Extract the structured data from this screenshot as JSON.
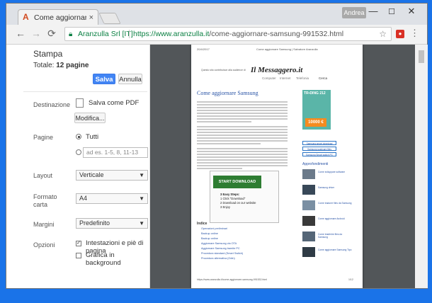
{
  "browser": {
    "tab_title": "Come aggiornare Samsu",
    "tab_close": "×",
    "user": "Andrea",
    "window_controls": [
      "—",
      "☐",
      "✕"
    ],
    "nav": [
      "←",
      "→",
      "⟳"
    ],
    "site_name": "Aranzulla Srl [IT]",
    "url_host": "https://www.aranzulla.it",
    "url_path": "/come-aggiornare-samsung-991532.html",
    "menu_icon": "⋮",
    "bookmark_icon": "☆"
  },
  "print": {
    "title": "Stampa",
    "total_label": "Totale:",
    "total_value": "12 pagine",
    "save_label": "Salva",
    "cancel_label": "Annulla",
    "destination_label": "Destinazione",
    "destination_value": "Salva come PDF",
    "modify_label": "Modifica...",
    "pages_label": "Pagine",
    "pages_all": "Tutti",
    "pages_range_placeholder": "ad es. 1-5, 8, 11-13",
    "layout_label": "Layout",
    "layout_value": "Verticale",
    "paper_label": "Formato carta",
    "paper_value": "A4",
    "margins_label": "Margini",
    "margins_value": "Predefinito",
    "options_label": "Opzioni",
    "opt_headers": "Intestazioni e piè di pagina",
    "opt_background": "Grafica in background",
    "opt_headers_checked": true,
    "opt_background_checked": false
  },
  "preview": {
    "date": "20/4/2017",
    "header_title": "Come aggiornare Samsung | Salvatore Aranzulla",
    "top_note": "Questo sito contribuisce alla audience di",
    "logo": "Il Messaggero.it",
    "nav_items": [
      "Computer",
      "Internet",
      "Telefonia"
    ],
    "cerca": "Cerca",
    "article_title": "Come aggiornare Samsung",
    "ad_text": "TR▪DING 212",
    "ad_offer": "10000 €",
    "side_buttons": [
      "Samsung smart download",
      "Samsung scaricare files",
      "Samsung Smart switch PC"
    ],
    "approfondimenti": "Approfondimenti",
    "related": [
      "Come sviluppare software",
      "Samsung driver",
      "Come tradurre files da Samsung",
      "Come aggiornare Android",
      "Come trasferire files da Samsung",
      "Come aggiornare Samsung Tipo"
    ],
    "download_button": "START DOWNLOAD",
    "steps": [
      "3 Easy Steps:",
      "1 Click \"Download\"",
      "2 Download on our website",
      "3 Enjoy"
    ],
    "indice": "Indice",
    "index_items": [
      "Operazioni preliminari",
      "Backup online",
      "Backup online",
      "Aggiornare Samsung via OTA",
      "Aggiornare Samsung tramite PC",
      "Procedura standard (Smart Switch)",
      "Procedura alternativa (Odin)"
    ],
    "footer_url": "https://www.aranzulla.it/come-aggiornare-samsung-991532.html",
    "footer_page": "1/12"
  }
}
